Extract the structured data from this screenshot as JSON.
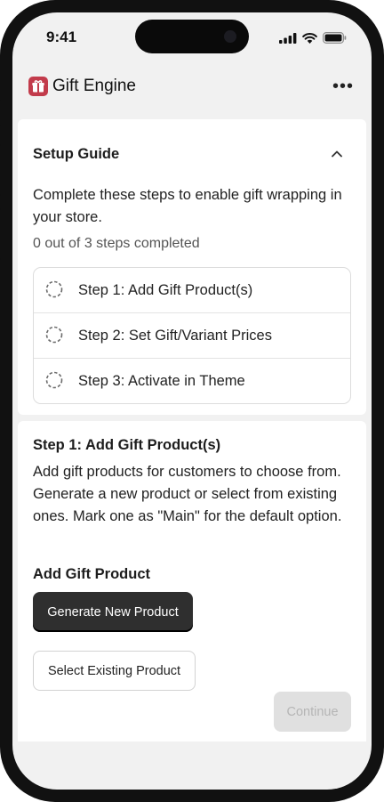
{
  "status_bar": {
    "time": "9:41"
  },
  "app": {
    "title": "Gift Engine"
  },
  "setup_guide": {
    "title": "Setup Guide",
    "description": "Complete these steps to enable gift wrapping in your store.",
    "progress": "0 out of 3 steps completed",
    "steps": [
      {
        "label": "Step 1: Add Gift Product(s)"
      },
      {
        "label": "Step 2: Set Gift/Variant Prices"
      },
      {
        "label": "Step 3: Activate in Theme"
      }
    ]
  },
  "step_detail": {
    "title": "Step 1: Add Gift Product(s)",
    "description": "Add gift products for customers to choose from. Generate a new product or select from existing ones. Mark one as \"Main\" for the default option.",
    "subheading": "Add Gift Product",
    "generate_label": "Generate New Product",
    "select_label": "Select Existing Product",
    "continue_label": "Continue"
  },
  "colors": {
    "logo": "#c23b4b",
    "primary_button": "#2f2f2f",
    "disabled_button": "#e0e0e0",
    "background": "#f1f1f1"
  }
}
